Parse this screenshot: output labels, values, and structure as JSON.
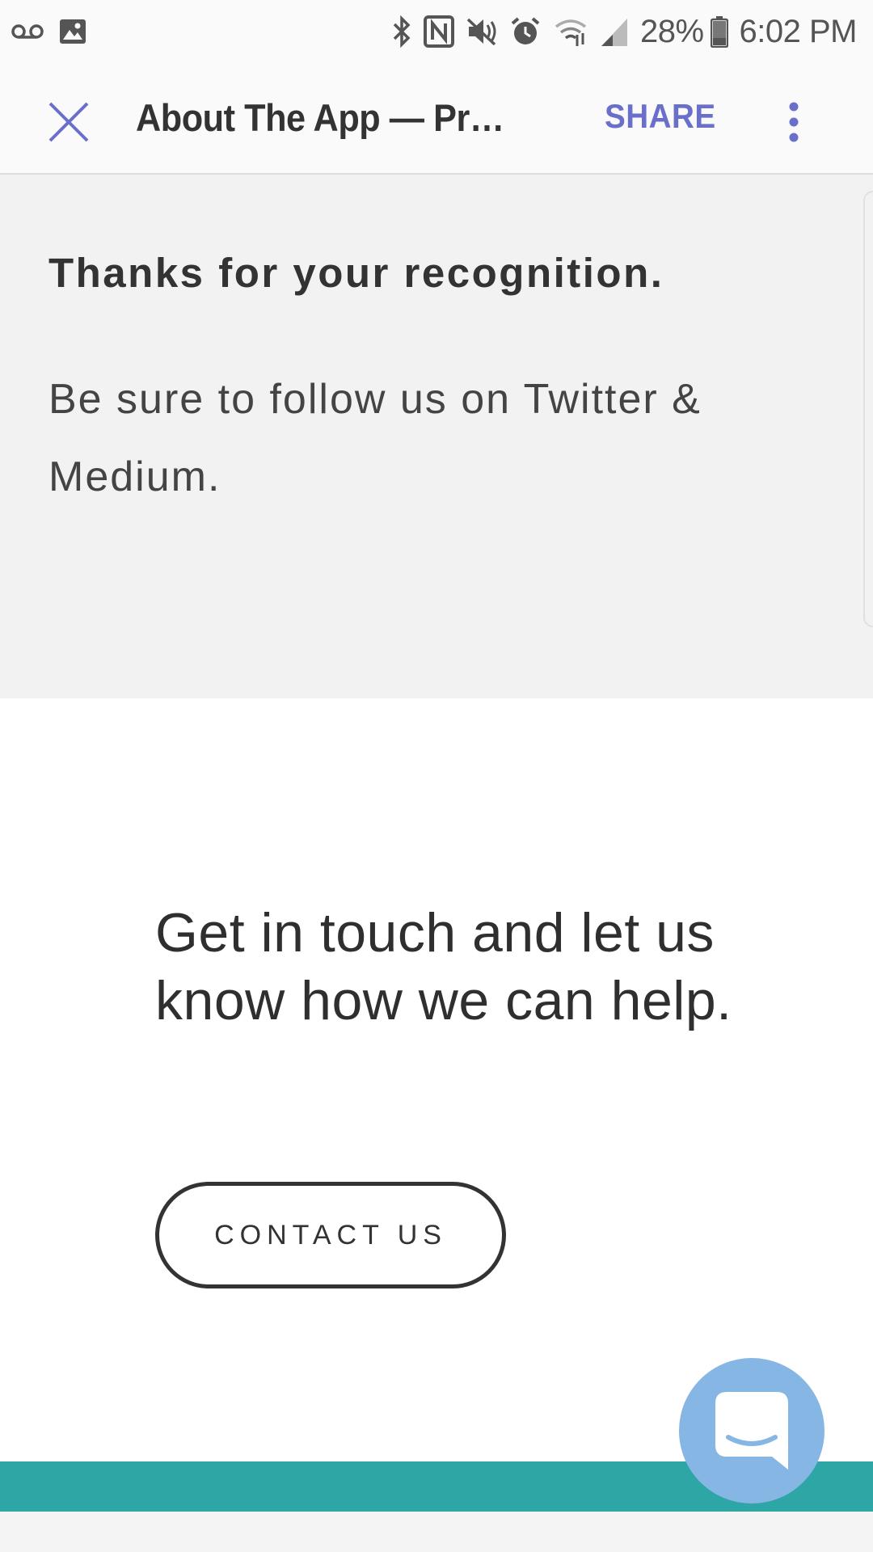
{
  "status_bar": {
    "battery_percent": "28%",
    "time": "6:02 PM",
    "left_icons": [
      "voicemail-icon",
      "image-icon"
    ],
    "right_icons": [
      "bluetooth-icon",
      "nfc-icon",
      "mute-icon",
      "alarm-icon",
      "wifi-icon",
      "signal-icon",
      "battery-icon"
    ]
  },
  "toolbar": {
    "title": "About The App — Precision",
    "share_label": "SHARE",
    "accent_color": "#6a6fc9"
  },
  "gray_section": {
    "heading": "Thanks for your recognition.",
    "body": "Be sure to follow us on Twitter & Medium."
  },
  "contact_section": {
    "heading": "Get in touch and let us know how we can help.",
    "button_label": "CONTACT US"
  },
  "colors": {
    "teal_band": "#2ea6a6",
    "chat_launcher": "#86b6e3"
  }
}
